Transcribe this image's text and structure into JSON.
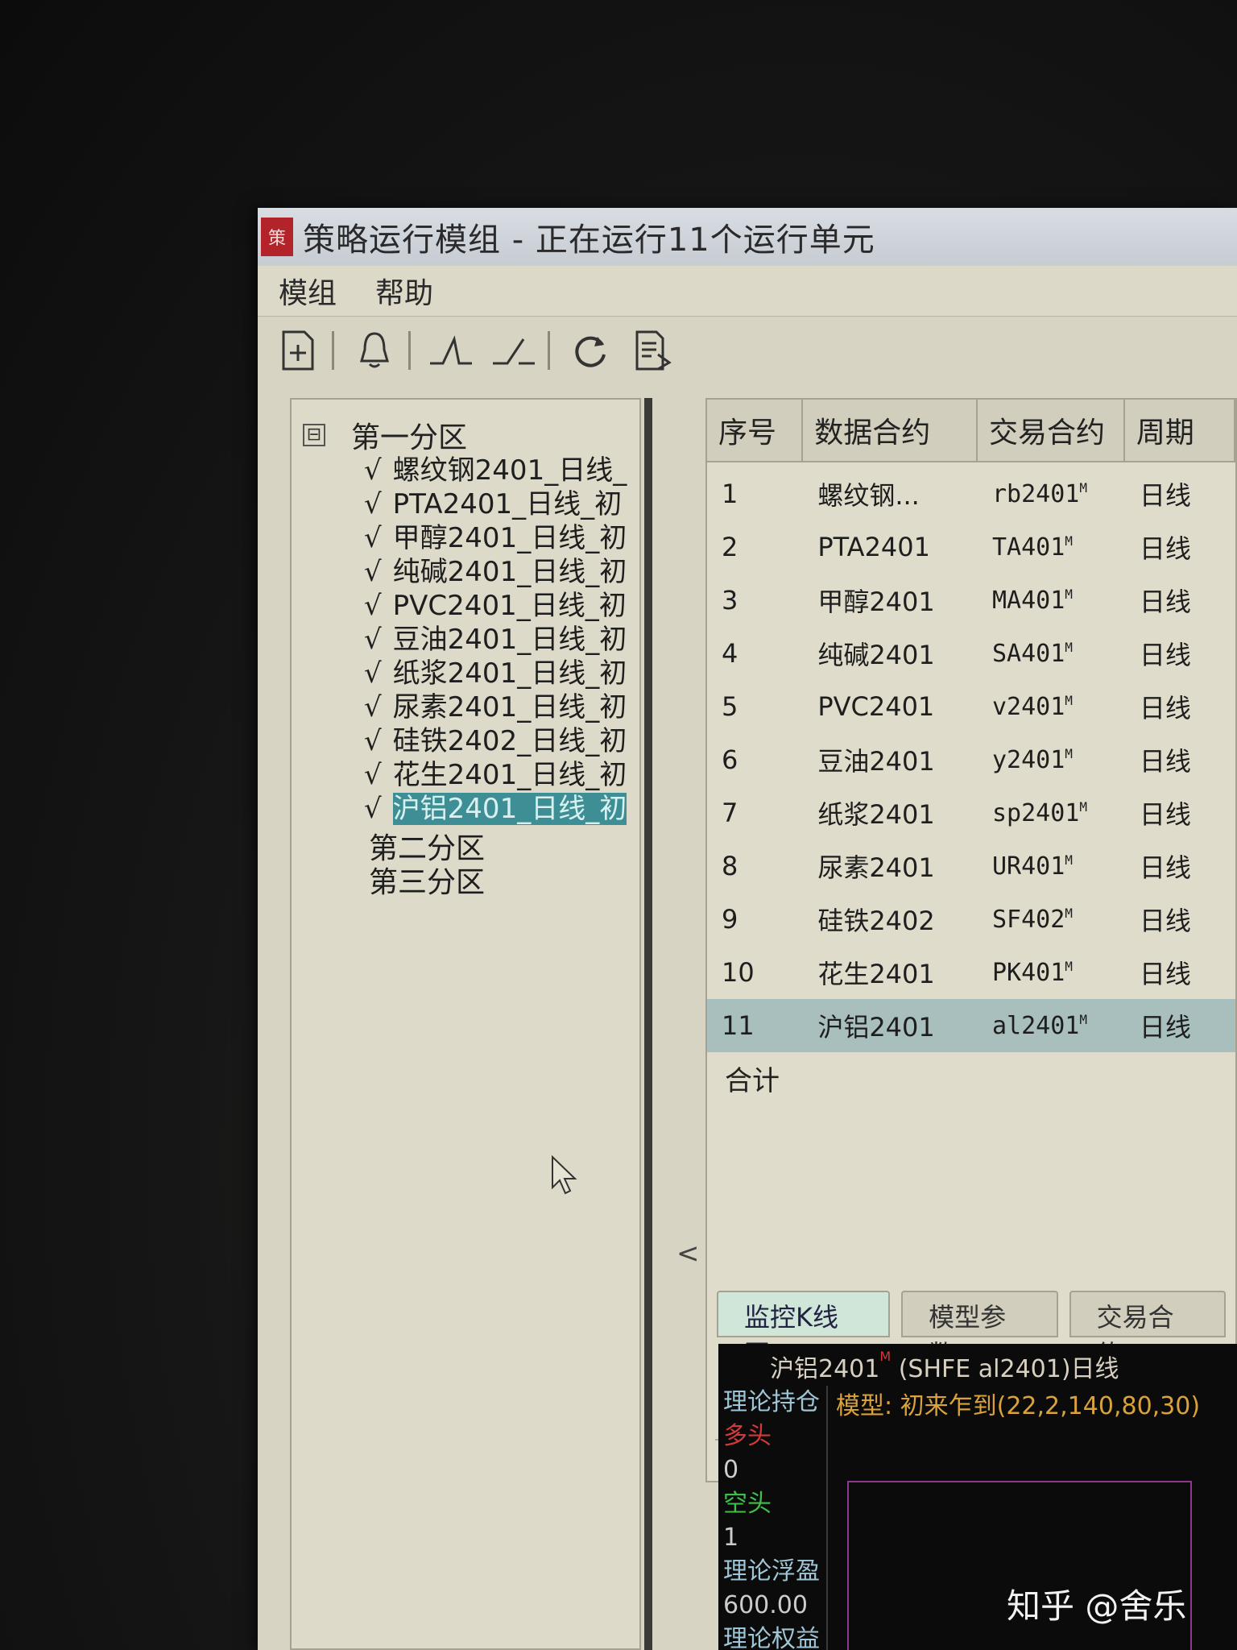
{
  "window": {
    "title": "策略运行模组 - 正在运行11个运行单元",
    "icon_glyph": "策"
  },
  "menu": [
    "模组",
    "帮助"
  ],
  "toolbar": {
    "icons": [
      "new-doc-icon",
      "bell-icon",
      "rising-edge-icon",
      "falling-edge-icon",
      "refresh-icon",
      "report-icon"
    ]
  },
  "tree": {
    "root_label": "第一分区",
    "collapse_glyph": "⊟",
    "items": [
      {
        "check": "√",
        "label": "螺纹钢2401_日线_"
      },
      {
        "check": "√",
        "label": "PTA2401_日线_初"
      },
      {
        "check": "√",
        "label": "甲醇2401_日线_初"
      },
      {
        "check": "√",
        "label": "纯碱2401_日线_初"
      },
      {
        "check": "√",
        "label": "PVC2401_日线_初"
      },
      {
        "check": "√",
        "label": "豆油2401_日线_初"
      },
      {
        "check": "√",
        "label": "纸浆2401_日线_初"
      },
      {
        "check": "√",
        "label": "尿素2401_日线_初"
      },
      {
        "check": "√",
        "label": "硅铁2402_日线_初"
      },
      {
        "check": "√",
        "label": "花生2401_日线_初"
      },
      {
        "check": "√",
        "label": "沪铝2401_日线_初"
      }
    ],
    "other_partitions": [
      "第二分区",
      "第三分区"
    ]
  },
  "grid": {
    "headers": [
      "序号",
      "数据合约",
      "交易合约",
      "周期"
    ],
    "rows": [
      {
        "no": "1",
        "data": "螺纹钢...",
        "trade": "rb2401",
        "mark": "M",
        "period": "日线"
      },
      {
        "no": "2",
        "data": "PTA2401",
        "trade": "TA401",
        "mark": "M",
        "period": "日线"
      },
      {
        "no": "3",
        "data": "甲醇2401",
        "trade": "MA401",
        "mark": "M",
        "period": "日线"
      },
      {
        "no": "4",
        "data": "纯碱2401",
        "trade": "SA401",
        "mark": "M",
        "period": "日线"
      },
      {
        "no": "5",
        "data": "PVC2401",
        "trade": "v2401",
        "mark": "M",
        "period": "日线"
      },
      {
        "no": "6",
        "data": "豆油2401",
        "trade": "y2401",
        "mark": "M",
        "period": "日线"
      },
      {
        "no": "7",
        "data": "纸浆2401",
        "trade": "sp2401",
        "mark": "M",
        "period": "日线"
      },
      {
        "no": "8",
        "data": "尿素2401",
        "trade": "UR401",
        "mark": "M",
        "period": "日线"
      },
      {
        "no": "9",
        "data": "硅铁2402",
        "trade": "SF402",
        "mark": "M",
        "period": "日线"
      },
      {
        "no": "10",
        "data": "花生2401",
        "trade": "PK401",
        "mark": "M",
        "period": "日线"
      },
      {
        "no": "11",
        "data": "沪铝2401",
        "trade": "al2401",
        "mark": "M",
        "period": "日线"
      }
    ],
    "total_label": "合计",
    "scroll_left_glyph": "<"
  },
  "tabs": [
    "监控K线图",
    "模型参数",
    "交易合约"
  ],
  "kchart": {
    "title": "沪铝2401",
    "title_mark": "M",
    "title_rest": " (SHFE al2401)日线",
    "model_text": "模型: 初来乍到(22,2,140,80,30)",
    "sidebar": [
      {
        "text": "理论持仓",
        "color": "#9fc6d6"
      },
      {
        "text": "多头",
        "color": "#d23a3a"
      },
      {
        "text": "0",
        "color": "#cccccc"
      },
      {
        "text": "空头",
        "color": "#3fbf4a"
      },
      {
        "text": "1",
        "color": "#cccccc"
      },
      {
        "text": "理论浮盈",
        "color": "#9fc6d6"
      },
      {
        "text": "600.00",
        "color": "#cccccc"
      },
      {
        "text": "理论权益",
        "color": "#9fc6d6"
      }
    ]
  },
  "watermark": "知乎 @舍乐"
}
